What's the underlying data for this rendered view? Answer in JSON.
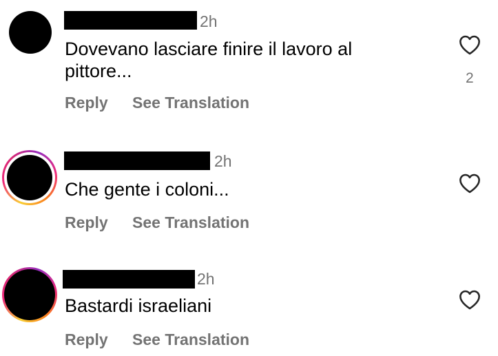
{
  "comments": [
    {
      "username": "",
      "time": "2h",
      "text_line1": "Dovevano lasciare finire il lavoro al",
      "text_line2": "pittore...",
      "reply_label": "Reply",
      "translate_label": "See Translation",
      "like_count": "2",
      "avatar_story_ring": false
    },
    {
      "username": "",
      "time": "2h",
      "text_line1": "Che gente i coloni...",
      "reply_label": "Reply",
      "translate_label": "See Translation",
      "avatar_story_ring": true
    },
    {
      "username": "",
      "time": "2h",
      "text_line1": "Bastardi israeliani",
      "reply_label": "Reply",
      "translate_label": "See Translation",
      "avatar_story_ring": true
    }
  ],
  "icons": {
    "like": "heart-outline-icon"
  },
  "colors": {
    "secondary_text": "#737373",
    "story_ring": [
      "#f9ce34",
      "#ee2a7b",
      "#962fbf"
    ]
  }
}
